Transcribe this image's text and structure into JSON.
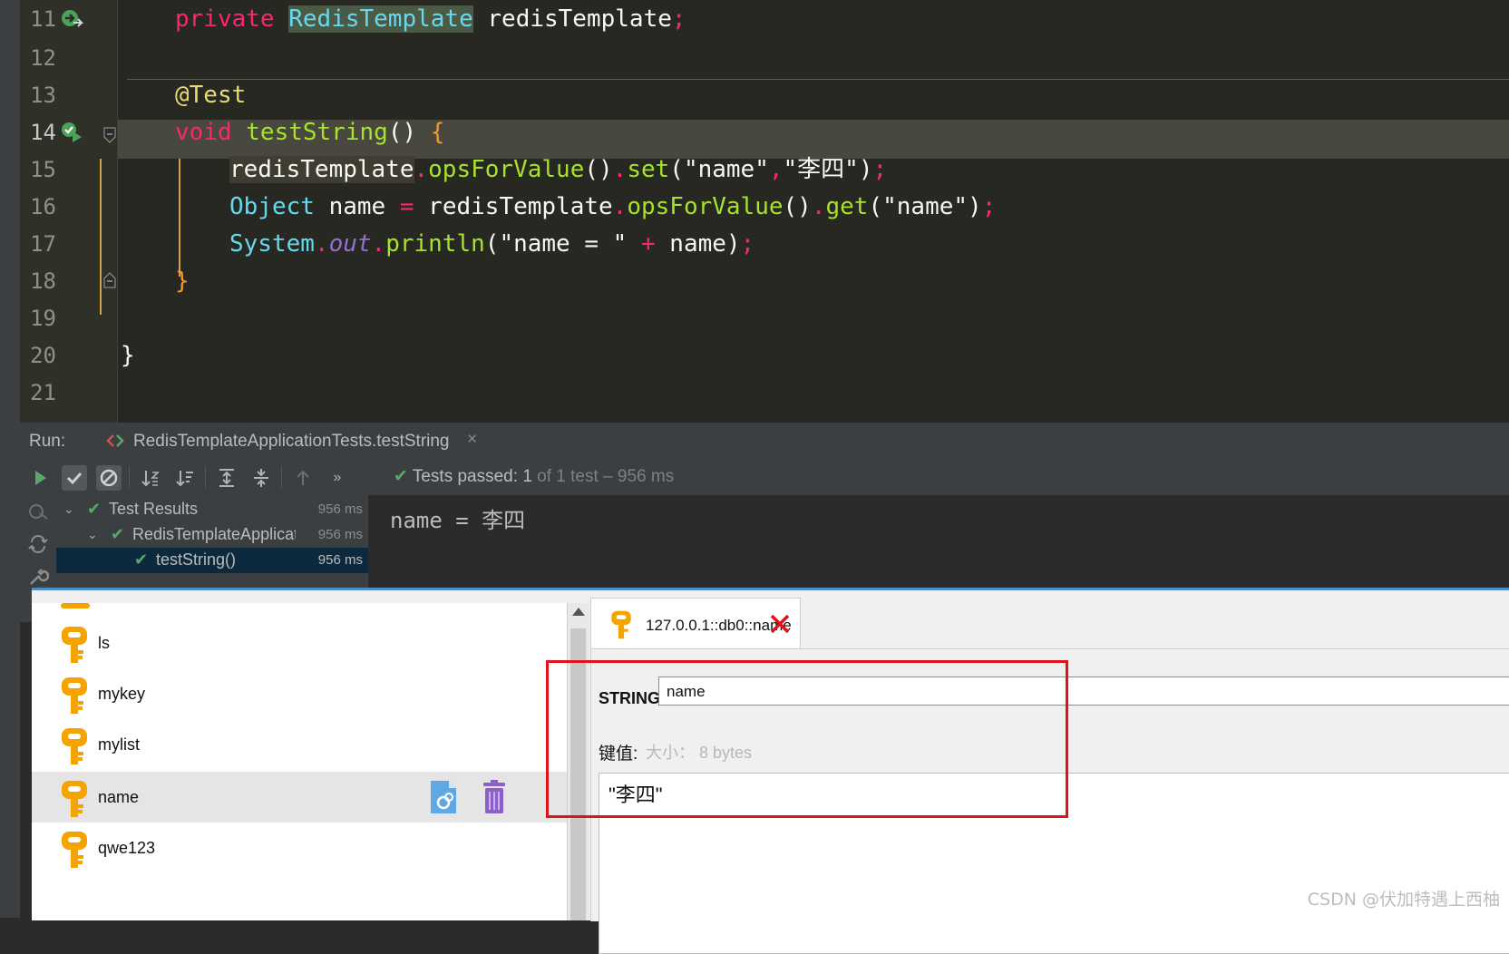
{
  "editor": {
    "lines": [
      {
        "n": "11"
      },
      {
        "n": "12"
      },
      {
        "n": "13"
      },
      {
        "n": "14"
      },
      {
        "n": "15"
      },
      {
        "n": "16"
      },
      {
        "n": "17"
      },
      {
        "n": "18"
      },
      {
        "n": "19"
      },
      {
        "n": "20"
      },
      {
        "n": "21"
      }
    ],
    "code": {
      "l11_kw": "private",
      "l11_type": "RedisTemplate",
      "l11_var": "redisTemplate",
      "l11_semi": ";",
      "l13_ann": "@Test",
      "l14_kw": "void",
      "l14_fn": "testString",
      "l14_paren": "()",
      "l14_brace": "{",
      "l15_var": "redisTemplate",
      "l15_dot1": ".",
      "l15_ops": "opsForValue",
      "l15_paren1": "()",
      "l15_dot2": ".",
      "l15_set": "set",
      "l15_open": "(",
      "l15_str1": "\"name\"",
      "l15_comma": ",",
      "l15_str2": "\"李四\"",
      "l15_close": ")",
      "l15_semi": ";",
      "l16_type": "Object",
      "l16_name": "name",
      "l16_eq": "=",
      "l16_var": "redisTemplate",
      "l16_dot1": ".",
      "l16_ops": "opsForValue",
      "l16_paren": "()",
      "l16_dot2": ".",
      "l16_get": "get",
      "l16_open": "(",
      "l16_str": "\"name\"",
      "l16_close": ")",
      "l16_semi": ";",
      "l17_sys": "System",
      "l17_dot1": ".",
      "l17_out": "out",
      "l17_dot2": ".",
      "l17_println": "println",
      "l17_open": "(",
      "l17_str": "\"name = \"",
      "l17_plus": "+",
      "l17_name": "name",
      "l17_close": ")",
      "l17_semi": ";",
      "l18_brace": "}",
      "l20_brace": "}"
    }
  },
  "run_panel": {
    "label": "Run:",
    "tab_title": "RedisTemplateApplicationTests.testString",
    "tab_close": "×",
    "status_prefix": "Tests passed:",
    "status_count": "1",
    "status_rest": "of 1 test – 956 ms",
    "tree": [
      {
        "label": "Test Results",
        "time": "956 ms"
      },
      {
        "label": "RedisTemplateApplicationTests",
        "time": "956 ms"
      },
      {
        "label": "testString()",
        "time": "956 ms"
      }
    ],
    "console_output": "name = 李四"
  },
  "rdm": {
    "keys": [
      {
        "name": "ls"
      },
      {
        "name": "mykey"
      },
      {
        "name": "mylist"
      },
      {
        "name": "name"
      },
      {
        "name": "qwe123"
      }
    ],
    "tab_title": "127.0.0.1::db0::name",
    "type_label": "STRING:",
    "key_value": "name",
    "value_label": "键值:",
    "size_label": "大小：",
    "size_value": "8 bytes",
    "value_content": "\"李四\""
  },
  "watermark": "CSDN @伏加特遇上西柚",
  "colors": {
    "accent_red": "#e0121b",
    "key_orange": "#f5a300",
    "test_pass_green": "#59a869"
  }
}
